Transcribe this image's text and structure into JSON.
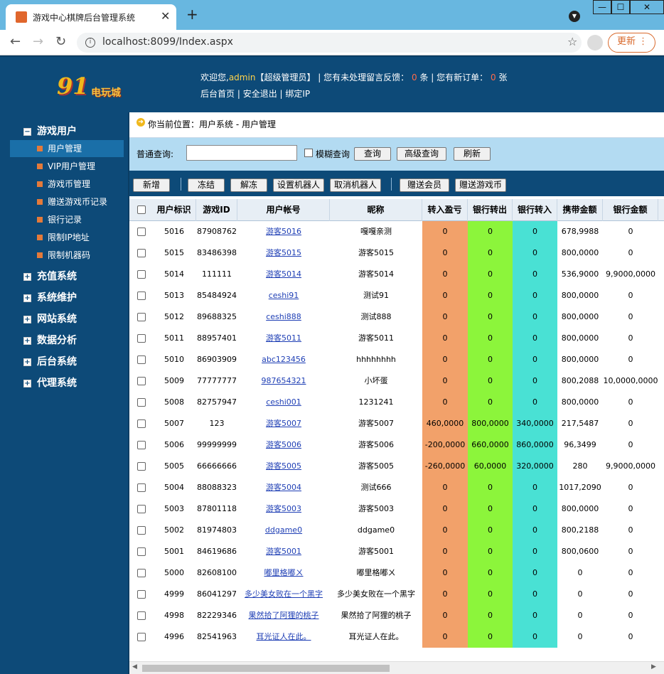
{
  "browser": {
    "tab_title": "游戏中心棋牌后台管理系统",
    "tab_close": "✕",
    "new_tab": "+",
    "url": "localhost:8099/Index.aspx",
    "update_label": "更新",
    "min": "—",
    "max": "☐",
    "close": "✕"
  },
  "header": {
    "logo_num": "91",
    "logo_text": "电玩城",
    "welcome_prefix": "欢迎您,",
    "username": "admin",
    "role": "【超级管理员】",
    "sep1": " | ",
    "feedback_prefix": "您有未处理留言反馈：",
    "feedback_count": "0",
    "feedback_unit": "条",
    "sep2": " | ",
    "orders_prefix": "您有新订单：",
    "orders_count": "0",
    "orders_unit": "张",
    "links": [
      "后台首页",
      "安全退出",
      "绑定IP"
    ]
  },
  "sidebar": {
    "groups": [
      {
        "label": "游戏用户",
        "expanded": true
      },
      {
        "label": "充值系统",
        "expanded": false
      },
      {
        "label": "系统维护",
        "expanded": false
      },
      {
        "label": "网站系统",
        "expanded": false
      },
      {
        "label": "数据分析",
        "expanded": false
      },
      {
        "label": "后台系统",
        "expanded": false
      },
      {
        "label": "代理系统",
        "expanded": false
      }
    ],
    "items": [
      "用户管理",
      "VIP用户管理",
      "游戏币管理",
      "赠送游戏币记录",
      "银行记录",
      "限制IP地址",
      "限制机器码"
    ],
    "active_item": "用户管理"
  },
  "breadcrumb": "你当前位置：用户系统 - 用户管理",
  "search": {
    "label": "普通查询:",
    "value": "",
    "fuzzy_label": "模糊查询",
    "query_btn": "查询",
    "advanced_btn": "高级查询",
    "refresh_btn": "刷新"
  },
  "toolbar": {
    "add": "新增",
    "freeze": "冻结",
    "unfreeze": "解冻",
    "set_robot": "设置机器人",
    "cancel_robot": "取消机器人",
    "gift_member": "赠送会员",
    "gift_coins": "赠送游戏币"
  },
  "table": {
    "columns": [
      "用户标识",
      "游戏ID",
      "用户帐号",
      "昵称",
      "转入盈亏",
      "银行转出",
      "银行转入",
      "携带金额",
      "银行金额"
    ],
    "rows": [
      [
        "5016",
        "87908762",
        "游客5016",
        "嘎嘎亲测",
        "0",
        "0",
        "0",
        "678,9988",
        "0"
      ],
      [
        "5015",
        "83486398",
        "游客5015",
        "游客5015",
        "0",
        "0",
        "0",
        "800,0000",
        "0"
      ],
      [
        "5014",
        "111111",
        "游客5014",
        "游客5014",
        "0",
        "0",
        "0",
        "536,9000",
        "9,9000,0000"
      ],
      [
        "5013",
        "85484924",
        "ceshi91",
        "测试91",
        "0",
        "0",
        "0",
        "800,0000",
        "0"
      ],
      [
        "5012",
        "89688325",
        "ceshi888",
        "测试888",
        "0",
        "0",
        "0",
        "800,0000",
        "0"
      ],
      [
        "5011",
        "88957401",
        "游客5011",
        "游客5011",
        "0",
        "0",
        "0",
        "800,0000",
        "0"
      ],
      [
        "5010",
        "86903909",
        "abc123456",
        "hhhhhhhh",
        "0",
        "0",
        "0",
        "800,0000",
        "0"
      ],
      [
        "5009",
        "77777777",
        "987654321",
        "小坏蛋",
        "0",
        "0",
        "0",
        "800,2088",
        "10,0000,0000"
      ],
      [
        "5008",
        "82757947",
        "ceshi001",
        "1231241",
        "0",
        "0",
        "0",
        "800,0000",
        "0"
      ],
      [
        "5007",
        "123",
        "游客5007",
        "游客5007",
        "460,0000",
        "800,0000",
        "340,0000",
        "217,5487",
        "0"
      ],
      [
        "5006",
        "99999999",
        "游客5006",
        "游客5006",
        "-200,0000",
        "660,0000",
        "860,0000",
        "96,3499",
        "0"
      ],
      [
        "5005",
        "66666666",
        "游客5005",
        "游客5005",
        "-260,0000",
        "60,0000",
        "320,0000",
        "280",
        "9,9000,0000"
      ],
      [
        "5004",
        "88088323",
        "游客5004",
        "测试666",
        "0",
        "0",
        "0",
        "1017,2090",
        "0"
      ],
      [
        "5003",
        "87801118",
        "游客5003",
        "游客5003",
        "0",
        "0",
        "0",
        "800,0000",
        "0"
      ],
      [
        "5002",
        "81974803",
        "ddgame0",
        "ddgame0",
        "0",
        "0",
        "0",
        "800,2188",
        "0"
      ],
      [
        "5001",
        "84619686",
        "游客5001",
        "游客5001",
        "0",
        "0",
        "0",
        "800,0600",
        "0"
      ],
      [
        "5000",
        "82608100",
        "嘟里格嘟ㄨ",
        "嘟里格嘟ㄨ",
        "0",
        "0",
        "0",
        "0",
        "0"
      ],
      [
        "4999",
        "86041297",
        "多少美女败在一个黑字",
        "多少美女败在一个黑字",
        "0",
        "0",
        "0",
        "0",
        "0"
      ],
      [
        "4998",
        "82229346",
        "果然拾了阿狸的桃子",
        "果然拾了阿狸的桃子",
        "0",
        "0",
        "0",
        "0",
        "0"
      ],
      [
        "4996",
        "82541963",
        "耳光证人在此。",
        "耳光证人在此。",
        "0",
        "0",
        "0",
        "0",
        "0"
      ]
    ]
  },
  "colors": {
    "header_bg": "#0d4a78",
    "transfer_in": "#f2a16a",
    "bank_out": "#8cf53b",
    "bank_in": "#49e1d4",
    "link": "#1f3fb5"
  }
}
